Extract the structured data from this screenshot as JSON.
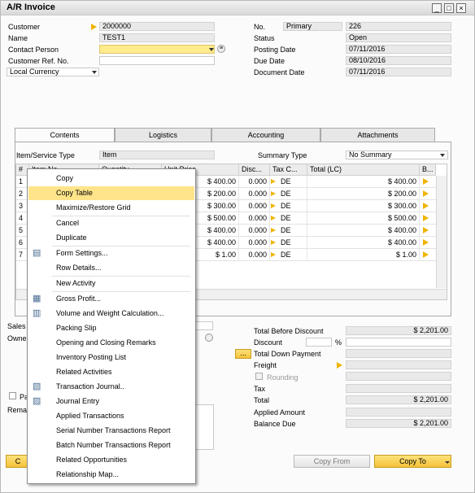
{
  "window": {
    "title": "A/R Invoice",
    "buttons": [
      "_",
      "□",
      "×"
    ]
  },
  "header_left": {
    "customer_label": "Customer",
    "customer_value": "2000000",
    "name_label": "Name",
    "name_value": "TEST1",
    "contact_label": "Contact Person",
    "contact_value": "",
    "ref_label": "Customer Ref. No.",
    "ref_value": "",
    "currency_value": "Local Currency"
  },
  "header_right": {
    "no_label": "No.",
    "series": "Primary",
    "no_value": "226",
    "status_label": "Status",
    "status_value": "Open",
    "posting_label": "Posting Date",
    "posting_value": "07/11/2016",
    "due_label": "Due Date",
    "due_value": "08/10/2016",
    "docdate_label": "Document Date",
    "docdate_value": "07/11/2016"
  },
  "tabs": [
    "Contents",
    "Logistics",
    "Accounting",
    "Attachments"
  ],
  "contents": {
    "item_type_label": "Item/Service Type",
    "item_type_value": "Item",
    "summary_label": "Summary Type",
    "summary_value": "No Summary",
    "columns": [
      "#",
      "Item No.",
      "Quantity",
      "Unit Price",
      "Disc...",
      "Tax C...",
      "Total (LC)",
      "B..."
    ],
    "rows": [
      {
        "n": "1",
        "price": "$ 400.00",
        "disc": "0.000",
        "tax": "DE",
        "total": "$ 400.00"
      },
      {
        "n": "2",
        "price": "$ 200.00",
        "disc": "0.000",
        "tax": "DE",
        "total": "$ 200.00"
      },
      {
        "n": "3",
        "price": "$ 300.00",
        "disc": "0.000",
        "tax": "DE",
        "total": "$ 300.00"
      },
      {
        "n": "4",
        "price": "$ 500.00",
        "disc": "0.000",
        "tax": "DE",
        "total": "$ 500.00"
      },
      {
        "n": "5",
        "price": "$ 400.00",
        "disc": "0.000",
        "tax": "DE",
        "total": "$ 400.00"
      },
      {
        "n": "6",
        "price": "$ 400.00",
        "disc": "0.000",
        "tax": "DE",
        "total": "$ 400.00"
      },
      {
        "n": "7",
        "price": "$ 1.00",
        "disc": "0.000",
        "tax": "DE",
        "total": "$ 1.00"
      }
    ]
  },
  "footer_left": {
    "sales_label": "Sales I",
    "owner_label": "Owne",
    "pa_label": "Pa",
    "remarks_label": "Remar"
  },
  "totals": {
    "before_discount_label": "Total Before Discount",
    "before_discount_value": "$ 2,201.00",
    "discount_label": "Discount",
    "percent": "%",
    "down_payment_label": "Total Down Payment",
    "dots": "...",
    "freight_label": "Freight",
    "rounding_label": "Rounding",
    "tax_label": "Tax",
    "total_label": "Total",
    "total_value": "$ 2,201.00",
    "applied_label": "Applied Amount",
    "balance_label": "Balance Due",
    "balance_value": "$ 2,201.00"
  },
  "buttons": {
    "copy_from": "Copy From",
    "copy_to": "Copy To",
    "left_btn": "C"
  },
  "context_menu": {
    "items": [
      {
        "label": "Copy",
        "icon": ""
      },
      {
        "label": "Copy Table",
        "icon": "",
        "highlight": true
      },
      {
        "label": "Maximize/Restore Grid",
        "icon": ""
      },
      {
        "label": "Cancel",
        "icon": ""
      },
      {
        "label": "Duplicate",
        "icon": ""
      },
      {
        "label": "Form Settings...",
        "icon": "form-settings-icon"
      },
      {
        "label": "Row Details...",
        "icon": ""
      },
      {
        "label": "New Activity",
        "icon": ""
      },
      {
        "label": "Gross Profit...",
        "icon": "gross-profit-icon"
      },
      {
        "label": "Volume and Weight Calculation...",
        "icon": "volume-weight-icon"
      },
      {
        "label": "Packing Slip",
        "icon": ""
      },
      {
        "label": "Opening and Closing Remarks",
        "icon": ""
      },
      {
        "label": "Inventory Posting List",
        "icon": ""
      },
      {
        "label": "Related Activities",
        "icon": ""
      },
      {
        "label": "Transaction Journal..",
        "icon": "transaction-journal-icon"
      },
      {
        "label": "Journal Entry",
        "icon": "journal-entry-icon"
      },
      {
        "label": "Applied Transactions",
        "icon": ""
      },
      {
        "label": "Serial Number Transactions Report",
        "icon": ""
      },
      {
        "label": "Batch Number Transactions Report",
        "icon": ""
      },
      {
        "label": "Related Opportunities",
        "icon": ""
      },
      {
        "label": "Relationship Map...",
        "icon": ""
      }
    ]
  },
  "colors": {
    "highlight": "#ffe48a",
    "arrow": "#f0b400",
    "yellow_field": "#ffeb8c"
  }
}
